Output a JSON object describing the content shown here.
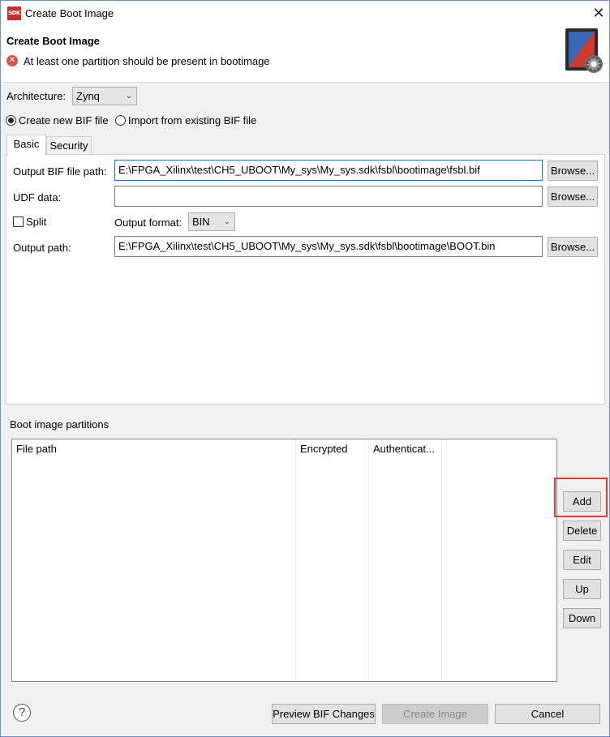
{
  "window": {
    "app_icon_text": "SDK",
    "title": "Create Boot Image",
    "close_glyph": "✕"
  },
  "header": {
    "title": "Create Boot Image",
    "error_message": "At least one partition should be present in bootimage",
    "error_icon": "error-icon",
    "wizard_icon": "boot-image-gear-icon"
  },
  "architecture": {
    "label": "Architecture:",
    "value": "Zynq"
  },
  "bif_mode": {
    "create_new_label": "Create new BIF file",
    "create_new_checked": true,
    "import_label": "Import from existing BIF file",
    "import_checked": false
  },
  "tabs": [
    {
      "label": "Basic",
      "active": true
    },
    {
      "label": "Security",
      "active": false
    }
  ],
  "basic": {
    "output_bif_label": "Output BIF file path:",
    "output_bif_value": "E:\\FPGA_Xilinx\\test\\CH5_UBOOT\\My_sys\\My_sys.sdk\\fsbl\\bootimage\\fsbl.bif",
    "udf_label": "UDF data:",
    "udf_value": "",
    "split_label": "Split",
    "split_checked": false,
    "output_format_label": "Output format:",
    "output_format_value": "BIN",
    "output_path_label": "Output path:",
    "output_path_value": "E:\\FPGA_Xilinx\\test\\CH5_UBOOT\\My_sys\\My_sys.sdk\\fsbl\\bootimage\\BOOT.bin",
    "browse_label": "Browse..."
  },
  "partitions": {
    "group_label": "Boot image partitions",
    "columns": [
      "File path",
      "Encrypted",
      "Authenticat..."
    ],
    "rows": [],
    "buttons": {
      "add": "Add",
      "delete": "Delete",
      "edit": "Edit",
      "up": "Up",
      "down": "Down"
    }
  },
  "footer": {
    "help_glyph": "?",
    "preview_label": "Preview BIF Changes",
    "create_label": "Create Image",
    "create_enabled": false,
    "cancel_label": "Cancel"
  },
  "colors": {
    "highlight": "#e53935",
    "error": "#d9534f",
    "dialog_bg": "#f0f0f0",
    "focus_border": "#0078d7"
  }
}
